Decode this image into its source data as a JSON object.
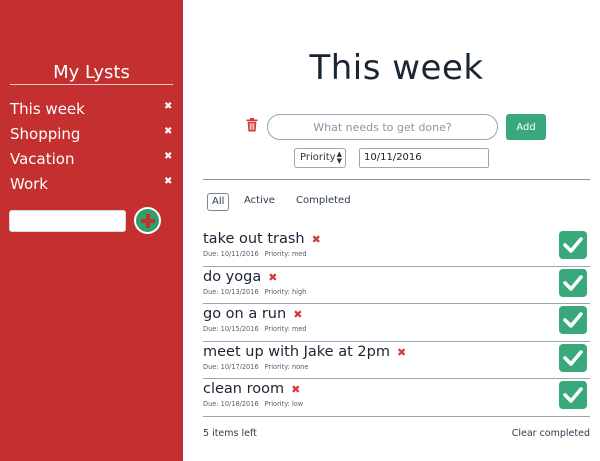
{
  "sidebar": {
    "title": "My Lysts",
    "items": [
      {
        "label": "This week",
        "remove": "✖"
      },
      {
        "label": "Shopping",
        "remove": "✖"
      },
      {
        "label": "Vacation",
        "remove": "✖"
      },
      {
        "label": "Work",
        "remove": "✖"
      }
    ],
    "new_lyst_value": "",
    "accent_color": "#c3302f",
    "add_button_color": "#2fa06b"
  },
  "main": {
    "title": "This week",
    "task_input_placeholder": "What needs to get done?",
    "add_label": "Add",
    "priority_label": "Priority",
    "date_value": "10/11/2016",
    "filters": [
      "All",
      "Active",
      "Completed"
    ],
    "active_filter": "All",
    "todos": [
      {
        "title": "take out trash",
        "remove": "✖",
        "due": "Due: 10/11/2016",
        "priority": "Priority: med",
        "completed": true
      },
      {
        "title": "do yoga",
        "remove": "✖",
        "due": "Due: 10/13/2016",
        "priority": "Priority: high",
        "completed": true
      },
      {
        "title": "go on a run",
        "remove": "✖",
        "due": "Due: 10/15/2016",
        "priority": "Priority: med",
        "completed": true
      },
      {
        "title": "meet up with Jake at 2pm",
        "remove": "✖",
        "due": "Due: 10/17/2016",
        "priority": "Priority: none",
        "completed": true
      },
      {
        "title": "clean room",
        "remove": "✖",
        "due": "Due: 10/18/2016",
        "priority": "Priority: low",
        "completed": true
      }
    ],
    "items_left": "5 items left",
    "clear_completed": "Clear completed",
    "check_color": "#39a87a",
    "remove_color": "#d33a3a"
  }
}
